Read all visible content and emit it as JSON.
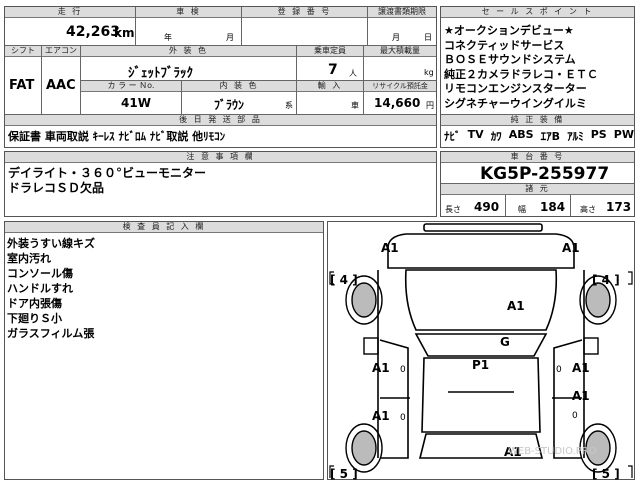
{
  "top": {
    "headers": {
      "mileage": "走 行",
      "inspection": "車 検",
      "registration": "登 録 番 号",
      "transfer_deadline": "譲渡書類期限"
    },
    "mileage_value": "42,263",
    "mileage_unit": "km",
    "inspection_year": "年",
    "inspection_month": "月",
    "transfer_month": "月",
    "transfer_day": "日",
    "shift_label": "シフト",
    "aircon_label": "エアコン",
    "exterior_color_label": "外 装 色",
    "capacity_label": "乗車定員",
    "max_load_label": "最大積載量",
    "shift_value": "FAT",
    "aircon_value": "AAC",
    "exterior_color": "ｼﾞｪｯﾄﾌﾞﾗｯｸ",
    "capacity_value": "7",
    "capacity_unit": "人",
    "max_load_unit": "kg",
    "color_no_label": "カ ラ ー Ｎo.",
    "interior_color_label": "内 装 色",
    "import_label": "輸 入",
    "recycle_label": "リサイクル預託金",
    "color_no_value": "41W",
    "interior_color": "ﾌﾞﾗｳﾝ",
    "interior_suffix": "系",
    "import_unit": "車",
    "recycle_value": "14,660",
    "recycle_unit": "円",
    "later_docs_header": "後 日 発 送 部 品",
    "later_docs_value": "保証書 車両取説 ｷｰﾚｽ ﾅﾋﾞﾛﾑ ﾅﾋﾞ取説 他ﾘﾓｺﾝ"
  },
  "sales": {
    "header": "セ ー ル ス ポ イ ン ト",
    "lines": [
      "★オークションデビュー★",
      "コネクティッドサービス",
      "ＢＯＳＥサウンドシステム",
      "純正２カメラドラレコ・ＥＴＣ",
      "リモコンエンジンスターター",
      "シグネチャーウイングイルミ"
    ],
    "equipment_header": "純 正 装 備",
    "equipment": [
      "ﾅﾋﾞ",
      "TV",
      "ｶﾜ",
      "ABS",
      "ｴｱB",
      "ｱﾙﾐ",
      "PS",
      "PW"
    ]
  },
  "notes": {
    "header": "注 意 事 項 欄",
    "lines": [
      "デイライト・３６０°ビューモニター",
      "ドラレコＳＤ欠品"
    ]
  },
  "chassis": {
    "header": "車 台 番 号",
    "value": "KG5P-255977",
    "dims_header": "諸 元",
    "length_label": "長さ",
    "length_value": "490",
    "width_label": "幅",
    "width_value": "184",
    "height_label": "高さ",
    "height_value": "173"
  },
  "inspector": {
    "header": "検 査 員 記 入 欄",
    "lines": [
      "外装うすい線キズ",
      "室内汚れ",
      "コンソール傷",
      "ハンドルすれ",
      "ドア内張傷",
      "下廻りＳ小",
      "ガラスフィルム張"
    ]
  },
  "diagram": {
    "marks": {
      "front_left_corner": "A1",
      "front_right_corner": "A1",
      "left_tire": "[ 4 ]",
      "right_tire": "[ 4 ]",
      "hood": "A1",
      "windshield": "G",
      "roof": "P1",
      "left_front_door": "A1",
      "left_front_door_ext": "0",
      "left_rear_door": "A1",
      "left_rear_door_ext": "0",
      "right_front_door": "A1",
      "right_front_door_ext": "0",
      "right_rear_door": "A1",
      "right_rear_door_ext": "0",
      "left_rear_tire": "[ 5 ]",
      "right_rear_tire": "[ 5 ]",
      "rear": "A1"
    },
    "watermark": "WEB-STUDIO.PRO"
  }
}
